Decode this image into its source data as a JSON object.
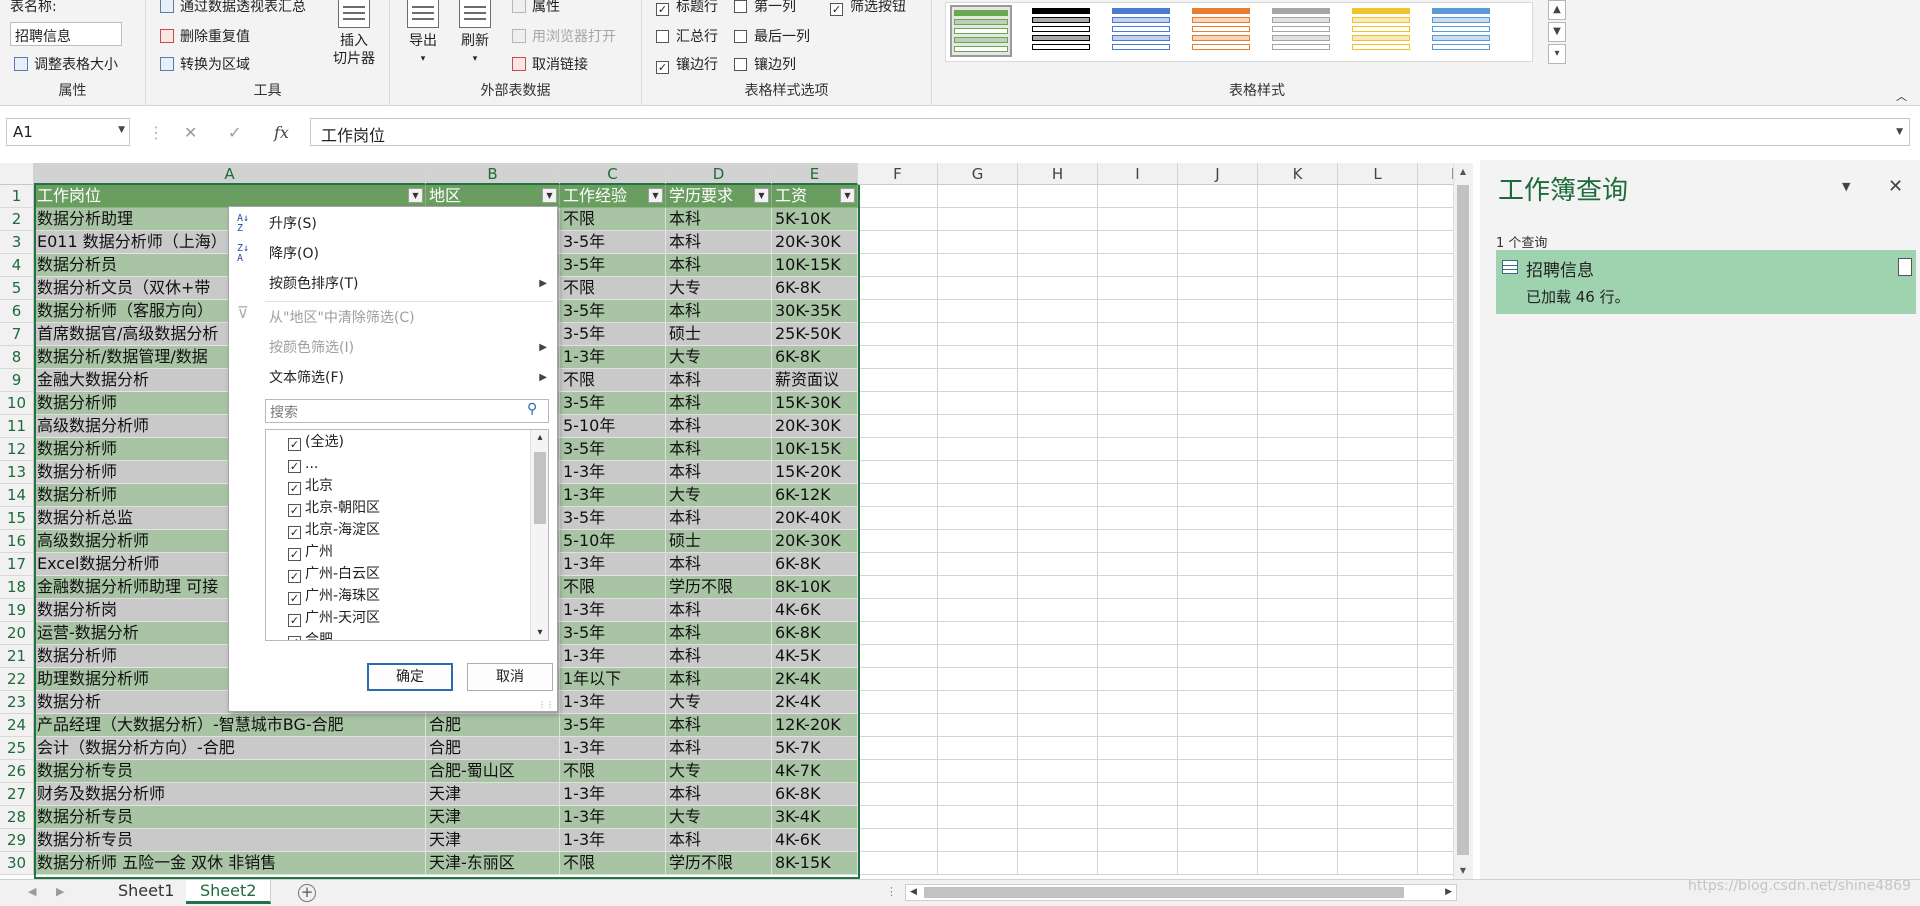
{
  "ribbon": {
    "properties": {
      "name_label": "表名称:",
      "name_value": "招聘信息",
      "resize_label": "调整表格大小",
      "group_title": "属性"
    },
    "tools": {
      "pivot_label": "通过数据透视表汇总",
      "remove_dup_label": "删除重复值",
      "convert_label": "转换为区域",
      "slicer_label": "插入\n切片器",
      "slicer_line1": "插入",
      "slicer_line2": "切片器",
      "group_title": "工具"
    },
    "external": {
      "export_label": "导出",
      "refresh_label": "刷新",
      "props_label": "属性",
      "browser_label": "用浏览器打开",
      "unlink_label": "取消链接",
      "group_title": "外部表数据"
    },
    "style_options": {
      "header_row": {
        "label": "标题行",
        "checked": true
      },
      "total_row": {
        "label": "汇总行",
        "checked": false
      },
      "banded_rows": {
        "label": "镶边行",
        "checked": true
      },
      "first_column": {
        "label": "第一列",
        "checked": false
      },
      "last_column": {
        "label": "最后一列",
        "checked": false
      },
      "banded_columns": {
        "label": "镶边列",
        "checked": false
      },
      "filter_button": {
        "label": "筛选按钮",
        "checked": true
      },
      "group_title": "表格样式选项"
    },
    "table_styles": {
      "group_title": "表格样式",
      "swatch_colors": [
        "#6aa84f",
        "#000000",
        "#4a7bd0",
        "#e97d2e",
        "#a5a5a5",
        "#f2c12e",
        "#5a9bd5"
      ]
    }
  },
  "formula_bar": {
    "name_box": "A1",
    "cancel_icon": "✕",
    "enter_icon": "✓",
    "fx_label": "fx",
    "content": "工作岗位"
  },
  "grid": {
    "columns": [
      "A",
      "B",
      "C",
      "D",
      "E",
      "F",
      "G",
      "H",
      "I",
      "J",
      "K",
      "L",
      "M"
    ],
    "header": [
      "工作岗位",
      "地区",
      "工作经验",
      "学历要求",
      "工资"
    ],
    "rows": [
      {
        "num": "2",
        "cells": [
          "数据分析助理",
          "",
          "不限",
          "本科",
          "5K-10K"
        ]
      },
      {
        "num": "3",
        "cells": [
          "E011 数据分析师（上海）",
          "",
          "3-5年",
          "本科",
          "20K-30K"
        ]
      },
      {
        "num": "4",
        "cells": [
          "数据分析员",
          "",
          "3-5年",
          "本科",
          "10K-15K"
        ]
      },
      {
        "num": "5",
        "cells": [
          "数据分析文员（双休+带",
          "",
          "不限",
          "大专",
          "6K-8K"
        ]
      },
      {
        "num": "6",
        "cells": [
          "数据分析师（客服方向）",
          "",
          "3-5年",
          "本科",
          "30K-35K"
        ]
      },
      {
        "num": "7",
        "cells": [
          "首席数据官/高级数据分析",
          "",
          "3-5年",
          "硕士",
          "25K-50K"
        ]
      },
      {
        "num": "8",
        "cells": [
          "数据分析/数据管理/数据",
          "",
          "1-3年",
          "大专",
          "6K-8K"
        ]
      },
      {
        "num": "9",
        "cells": [
          "金融大数据分析",
          "",
          "不限",
          "本科",
          "薪资面议"
        ]
      },
      {
        "num": "10",
        "cells": [
          "数据分析师",
          "",
          "3-5年",
          "本科",
          "15K-30K"
        ]
      },
      {
        "num": "11",
        "cells": [
          "高级数据分析师",
          "",
          "5-10年",
          "本科",
          "20K-30K"
        ]
      },
      {
        "num": "12",
        "cells": [
          "数据分析师",
          "",
          "3-5年",
          "本科",
          "10K-15K"
        ]
      },
      {
        "num": "13",
        "cells": [
          "数据分析师",
          "",
          "1-3年",
          "本科",
          "15K-20K"
        ]
      },
      {
        "num": "14",
        "cells": [
          "数据分析师",
          "",
          "1-3年",
          "大专",
          "6K-12K"
        ]
      },
      {
        "num": "15",
        "cells": [
          "数据分析总监",
          "",
          "3-5年",
          "本科",
          "20K-40K"
        ]
      },
      {
        "num": "16",
        "cells": [
          "高级数据分析师",
          "",
          "5-10年",
          "硕士",
          "20K-30K"
        ]
      },
      {
        "num": "17",
        "cells": [
          "Excel数据分析师",
          "",
          "1-3年",
          "本科",
          "6K-8K"
        ]
      },
      {
        "num": "18",
        "cells": [
          "金融数据分析师助理 可接",
          "",
          "不限",
          "学历不限",
          "8K-10K"
        ]
      },
      {
        "num": "19",
        "cells": [
          "数据分析岗",
          "",
          "1-3年",
          "本科",
          "4K-6K"
        ]
      },
      {
        "num": "20",
        "cells": [
          "运营-数据分析",
          "",
          "3-5年",
          "本科",
          "6K-8K"
        ]
      },
      {
        "num": "21",
        "cells": [
          "数据分析师",
          "",
          "1-3年",
          "本科",
          "4K-5K"
        ]
      },
      {
        "num": "22",
        "cells": [
          "助理数据分析师",
          "",
          "1年以下",
          "本科",
          "2K-4K"
        ]
      },
      {
        "num": "23",
        "cells": [
          "数据分析",
          "",
          "1-3年",
          "大专",
          "2K-4K"
        ]
      },
      {
        "num": "24",
        "cells": [
          "产品经理（大数据分析）-智慧城市BG-合肥",
          "合肥",
          "3-5年",
          "本科",
          "12K-20K"
        ]
      },
      {
        "num": "25",
        "cells": [
          "会计（数据分析方向）-合肥",
          "合肥",
          "1-3年",
          "本科",
          "5K-7K"
        ]
      },
      {
        "num": "26",
        "cells": [
          "数据分析专员",
          "合肥-蜀山区",
          "不限",
          "大专",
          "4K-7K"
        ]
      },
      {
        "num": "27",
        "cells": [
          "财务及数据分析师",
          "天津",
          "1-3年",
          "本科",
          "6K-8K"
        ]
      },
      {
        "num": "28",
        "cells": [
          "数据分析专员",
          "天津",
          "1-3年",
          "大专",
          "3K-4K"
        ]
      },
      {
        "num": "29",
        "cells": [
          "数据分析专员",
          "天津",
          "1-3年",
          "本科",
          "4K-6K"
        ]
      },
      {
        "num": "30",
        "cells": [
          "数据分析师 五险一金 双休 非销售",
          "天津-东丽区",
          "不限",
          "学历不限",
          "8K-15K"
        ]
      }
    ]
  },
  "filter_menu": {
    "sort_asc": "升序(S)",
    "sort_desc": "降序(O)",
    "sort_by_color": "按颜色排序(T)",
    "clear_filter": "从\"地区\"中清除筛选(C)",
    "filter_by_color": "按颜色筛选(I)",
    "text_filter": "文本筛选(F)",
    "search_placeholder": "搜索",
    "list": [
      {
        "label": "(全选)",
        "checked": true
      },
      {
        "label": "...",
        "checked": true
      },
      {
        "label": "北京",
        "checked": true
      },
      {
        "label": "北京-朝阳区",
        "checked": true
      },
      {
        "label": "北京-海淀区",
        "checked": true
      },
      {
        "label": "广州",
        "checked": true
      },
      {
        "label": "广州-白云区",
        "checked": true
      },
      {
        "label": "广州-海珠区",
        "checked": true
      },
      {
        "label": "广州-天河区",
        "checked": true
      },
      {
        "label": "合肥",
        "checked": true
      }
    ],
    "ok_label": "确定",
    "cancel_label": "取消"
  },
  "query_pane": {
    "title": "工作簿查询",
    "count": "1 个查询",
    "query_name": "招聘信息",
    "query_status": "已加载 46 行。"
  },
  "sheets": {
    "tabs": [
      "Sheet1",
      "Sheet2"
    ],
    "active": "Sheet2",
    "add_symbol": "+"
  },
  "watermark": "https://blog.csdn.net/shine4869",
  "colors": {
    "accent": "#217346",
    "table_header": "#6a9e60",
    "band_green": "#a9c4a5",
    "band_gray": "#c9c9c9"
  }
}
